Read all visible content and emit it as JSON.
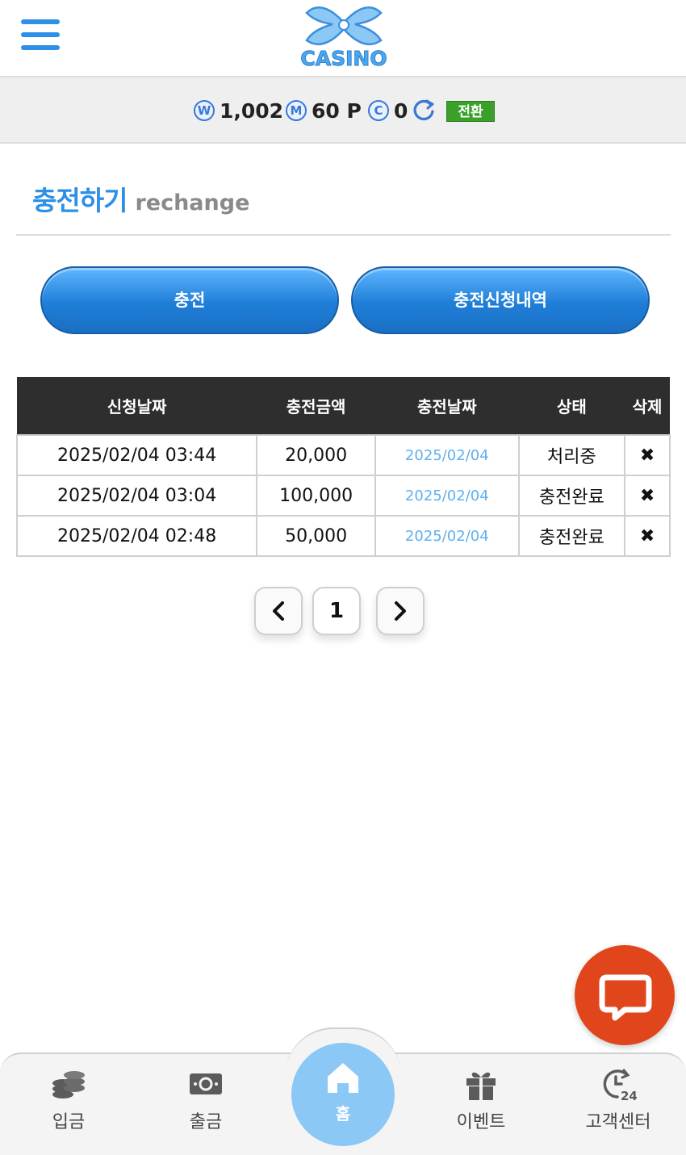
{
  "header": {
    "logo_text": "CASINO"
  },
  "balance": {
    "won_symbol": "W",
    "won_value": "1,002",
    "point_symbol": "M",
    "point_value": "60 P",
    "comp_symbol": "C",
    "comp_value": "0",
    "switch_label": "전환"
  },
  "page": {
    "title_ko": "충전하기",
    "title_en": "rechange"
  },
  "actions": {
    "charge_label": "충전",
    "history_label": "충전신청내역"
  },
  "table": {
    "headers": [
      "신청날짜",
      "충전금액",
      "충전날짜",
      "상태",
      "삭제"
    ],
    "rows": [
      {
        "request_date": "2025/02/04 03:44",
        "amount": "20,000",
        "charge_date": "2025/02/04",
        "status": "처리중",
        "delete": "✖"
      },
      {
        "request_date": "2025/02/04 03:04",
        "amount": "100,000",
        "charge_date": "2025/02/04",
        "status": "충전완료",
        "delete": "✖"
      },
      {
        "request_date": "2025/02/04 02:48",
        "amount": "50,000",
        "charge_date": "2025/02/04",
        "status": "충전완료",
        "delete": "✖"
      }
    ]
  },
  "pager": {
    "current": "1"
  },
  "bottom_nav": {
    "deposit": "입금",
    "withdraw": "출금",
    "home": "홈",
    "event": "이벤트",
    "support": "고객센터",
    "support_badge": "24"
  },
  "colors": {
    "accent": "#2d8fe6",
    "switch": "#3aa02a",
    "chat": "#e0451c",
    "home": "#8cc8f5"
  }
}
